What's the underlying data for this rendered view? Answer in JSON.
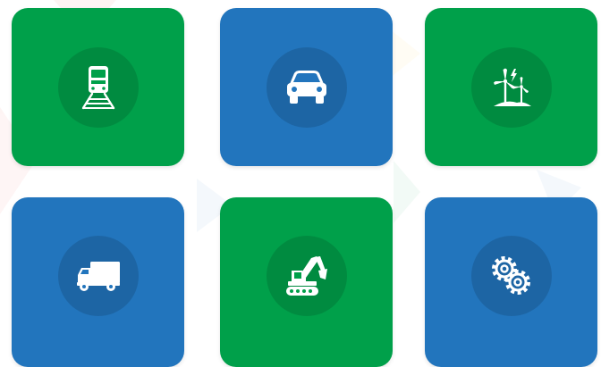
{
  "colors": {
    "green": "#00A04A",
    "blue": "#2275BD",
    "icon": "#ffffff"
  },
  "tiles": [
    {
      "icon": "train-icon",
      "color": "green"
    },
    {
      "icon": "car-icon",
      "color": "blue"
    },
    {
      "icon": "wind-turbine-icon",
      "color": "green"
    },
    {
      "icon": "truck-icon",
      "color": "blue"
    },
    {
      "icon": "excavator-icon",
      "color": "green"
    },
    {
      "icon": "gears-icon",
      "color": "blue"
    }
  ]
}
